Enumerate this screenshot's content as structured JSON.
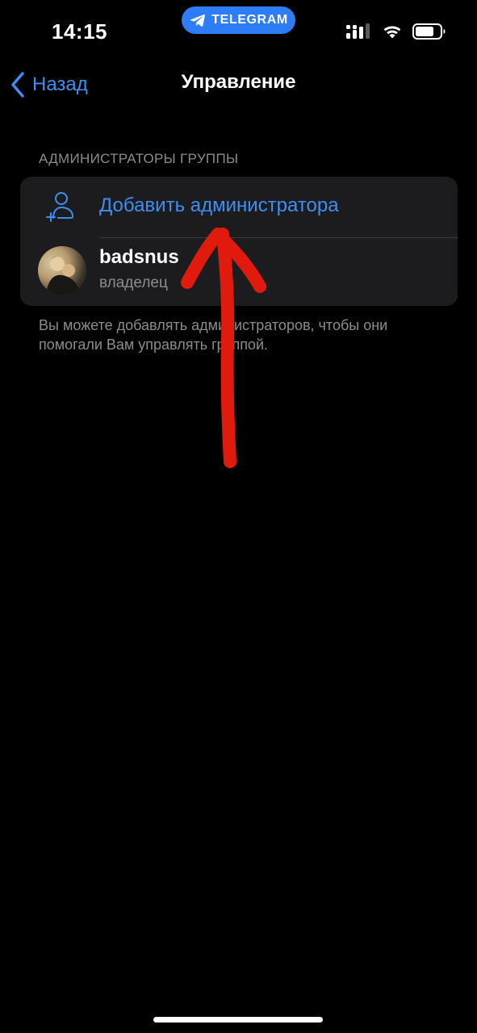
{
  "status_bar": {
    "time": "14:15",
    "pill_label": "TELEGRAM",
    "pill_color": "#2e7cf6",
    "icons": [
      "signal-icon",
      "wifi-icon",
      "battery-icon"
    ]
  },
  "nav": {
    "back_label": "Назад",
    "title": "Управление"
  },
  "section": {
    "header": "АДМИНИСТРАТОРЫ ГРУППЫ",
    "add_admin_label": "Добавить администратора",
    "admins": [
      {
        "name": "badsnus",
        "role": "владелец"
      }
    ],
    "footer": "Вы можете добавлять администраторов, чтобы они помогали Вам управлять группой."
  },
  "colors": {
    "accent": "#3d8ff2",
    "background": "#000000",
    "card": "#1c1c1e",
    "secondary_text": "#8b8b90",
    "annotation": "#e01a0c"
  }
}
